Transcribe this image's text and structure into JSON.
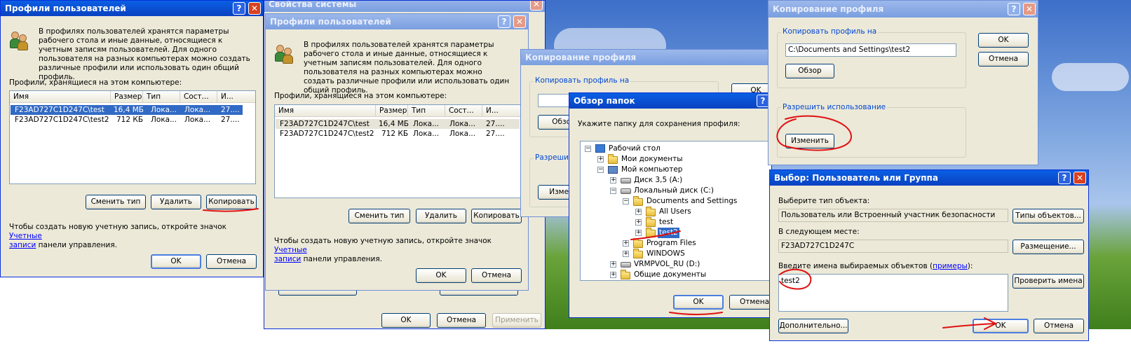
{
  "dlg1": {
    "title": "Профили пользователей",
    "help_glyph": "?",
    "close_glyph": "✕",
    "description": "В профилях пользователей хранятся параметры рабочего стола и иные данные, относящиеся к учетным записям пользователей. Для одного пользователя на разных компьютерах можно создать различные профили или использовать один общий профиль.",
    "profiles_label": "Профили, хранящиеся на этом компьютере:",
    "columns": [
      "Имя",
      "Размер",
      "Тип",
      "Сост...",
      "И..."
    ],
    "rows": [
      {
        "name": "F23AD727C1D247C\\test",
        "size": "16,4 МБ",
        "type": "Лока...",
        "status": "Лока...",
        "mod": "27...."
      },
      {
        "name": "F23AD727C1D247C\\test2",
        "size": "712 КБ",
        "type": "Лока...",
        "status": "Лока...",
        "mod": "27...."
      }
    ],
    "change_type": "Сменить тип",
    "delete": "Удалить",
    "copy": "Копировать",
    "note_prefix": "Чтобы создать новую учетную запись, откройте значок ",
    "note_link_1": "Учетные",
    "note_link_2": "записи",
    "note_suffix": " панели управления.",
    "ok": "OK",
    "cancel": "Отмена"
  },
  "sysprops": {
    "title": "Свойства системы",
    "ok": "OK",
    "cancel": "Отмена",
    "apply": "Применить"
  },
  "dlg2": {
    "title": "Профили пользователей",
    "description": "В профилях пользователей хранятся параметры рабочего стола и иные данные, относящиеся к учетным записям пользователей. Для одного пользователя на разных компьютерах можно создать различные профили или использовать один общий профиль.",
    "profiles_label": "Профили, хранящиеся на этом компьютере:",
    "columns": [
      "Имя",
      "Размер",
      "Тип",
      "Сост...",
      "И..."
    ],
    "rows": [
      {
        "name": "F23AD727C1D247C\\test",
        "size": "16,4 МБ",
        "type": "Лока...",
        "status": "Лока...",
        "mod": "27...."
      },
      {
        "name": "F23AD727C1D247C\\test2",
        "size": "712 КБ",
        "type": "Лока...",
        "status": "Лока...",
        "mod": "27...."
      }
    ],
    "change_type": "Сменить тип",
    "delete": "Удалить",
    "copy": "Копировать",
    "note_prefix": "Чтобы создать новую учетную запись, откройте значок ",
    "note_link_1": "Учетные",
    "note_link_2": "записи",
    "note_suffix": " панели управления.",
    "ok": "OK",
    "cancel": "Отмена"
  },
  "copy_bg": {
    "title": "Копирование профиля",
    "copy_to_label": "Копировать профиль на",
    "browse": "Обзор",
    "allow_label": "Разрешит",
    "change": "Измени",
    "ok": "OK"
  },
  "browse": {
    "title": "Обзор папок",
    "instruction": "Укажите папку для сохранения профиля:",
    "tree": {
      "desktop": "Рабочий стол",
      "my_docs": "Мои документы",
      "my_computer": "Мой компьютер",
      "floppy": "Диск 3,5 (A:)",
      "local_disk": "Локальный диск (C:)",
      "docs_settings": "Documents and Settings",
      "all_users": "All Users",
      "test": "test",
      "test2": "test2",
      "program_files": "Program Files",
      "windows": "WINDOWS",
      "vrmpvol": "VRMPVOL_RU (D:)",
      "shared_docs": "Общие документы"
    },
    "ok": "OK",
    "cancel": "Отмена"
  },
  "copy": {
    "title": "Копирование профиля",
    "copy_to_label": "Копировать профиль на",
    "path": "C:\\Documents and Settings\\test2",
    "browse": "Обзор",
    "allow_label": "Разрешить использование",
    "change": "Изменить",
    "ok": "OK",
    "cancel": "Отмена"
  },
  "select": {
    "title": "Выбор: Пользователь или Группа",
    "obj_type_label": "Выберите тип объекта:",
    "obj_type_value": "Пользователь или Встроенный участник безопасности",
    "obj_types_btn": "Типы объектов...",
    "location_label": "В следующем месте:",
    "location_value": "F23AD727C1D247C",
    "location_btn": "Размещение...",
    "names_label_prefix": "Введите имена выбираемых объектов (",
    "names_link": "примеры",
    "names_label_suffix": "):",
    "names_value": "test2",
    "check_names": "Проверить имена",
    "advanced": "Дополнительно...",
    "ok": "OK",
    "cancel": "Отмена"
  },
  "colors": {
    "title_active": "#0a4fd0",
    "selection": "#316ac5",
    "annotation": "#e01010",
    "dialog_face": "#ece9d8"
  }
}
